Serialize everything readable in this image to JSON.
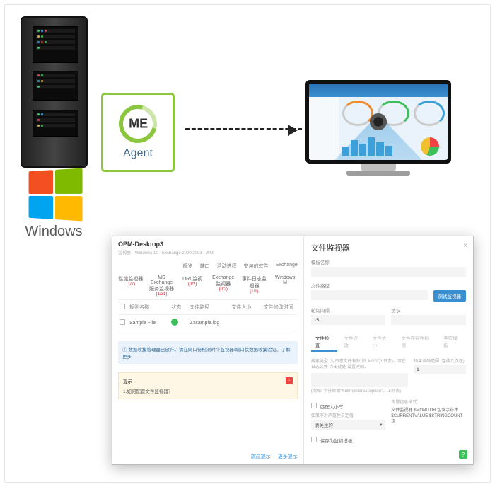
{
  "server_label": "Windows",
  "agent": {
    "logo": "ME",
    "label": "Agent"
  },
  "panel": {
    "title": "OPM-Desktop3",
    "subtitle": "监视器：Windows 10 · Exchange 2000/2003 · WMI",
    "nav": [
      "概览",
      "端口",
      "活动进程",
      "安装的软件",
      "Exchange"
    ],
    "tabs": [
      {
        "label": "性能监视器",
        "count": "(1/7)"
      },
      {
        "label": "MS Exchange服务监视器",
        "count": "(1/31)",
        "bad": true
      },
      {
        "label": "URL监视",
        "count": "(0/2)"
      },
      {
        "label": "Exchange监视器",
        "count": "(0/2)"
      },
      {
        "label": "事件日志监视器",
        "count": "(1/1)"
      },
      {
        "label": "Windows M"
      }
    ],
    "columns": [
      "规则名称",
      "状态",
      "文件路径",
      "文件大小",
      "文件修改时间"
    ],
    "row": {
      "name": "Sample File",
      "path": "Z:\\sample.log"
    },
    "banner": "数据收集管理器已放弃。请在网口待检测时个监视器/端口状数据收集验证。了解更多",
    "tip": {
      "title": "提示",
      "body": "1.如何配置文件监视器？",
      "link1": "跳过提示",
      "link2": "更多提示"
    }
  },
  "sidepanel": {
    "title": "文件监视器",
    "close": "×",
    "f_modname": "模板名称",
    "f_filepath": "文件路径",
    "btn_test": "测试监视器",
    "f_interval": "轮询间隔",
    "interval_val": "15",
    "f_proto": "协议",
    "rtabs": [
      "文件检查",
      "文件修改",
      "文件大小",
      "文件存在性检测",
      "字符模板"
    ],
    "box_label": "搜索类型 (对日志文件有效(如: MSSQL日志)。请在日志文件 点击此处 设置时间。",
    "box_note": "(例如: 字符串如\"NullPointerException\"。正则表)",
    "right_field": "结果条码范围 (连续几次在)",
    "right_val": "1",
    "chk_size": "匹配大小写",
    "chk_fail": "如果不对严重性自定值",
    "msg_label": "告警信息格式：",
    "msg_body": "文件监视器 $MONITOR 包含字符串 $CURRENTVALUE $STRINGCOUNT 次",
    "sel_val": "清关注的",
    "save": "保存为监视模板"
  }
}
